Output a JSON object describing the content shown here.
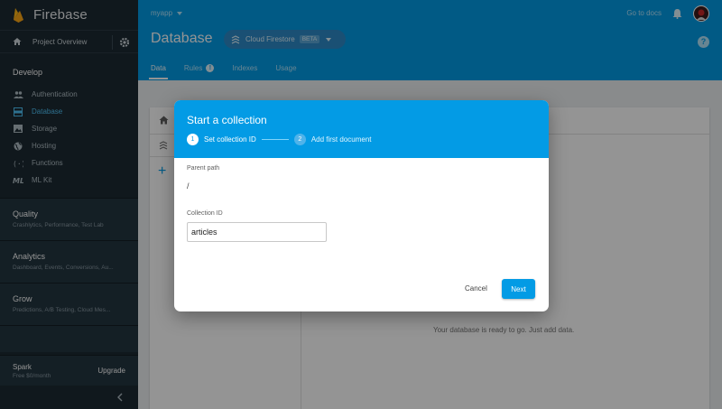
{
  "sidebar": {
    "brand": "Firebase",
    "overview": "Project Overview",
    "develop_title": "Develop",
    "develop_items": [
      {
        "label": "Authentication",
        "icon": "people-icon"
      },
      {
        "label": "Database",
        "icon": "database-icon"
      },
      {
        "label": "Storage",
        "icon": "image-icon"
      },
      {
        "label": "Hosting",
        "icon": "globe-icon"
      },
      {
        "label": "Functions",
        "icon": "functions-icon"
      },
      {
        "label": "ML Kit",
        "icon": "ml-icon"
      }
    ],
    "groups": [
      {
        "title": "Quality",
        "subtitle": "Crashlytics, Performance, Test Lab"
      },
      {
        "title": "Analytics",
        "subtitle": "Dashboard, Events, Conversions, Au..."
      },
      {
        "title": "Grow",
        "subtitle": "Predictions, A/B Testing, Cloud Mes..."
      }
    ],
    "plan": {
      "title": "Spark",
      "subtitle": "Free $0/month",
      "upgrade": "Upgrade"
    }
  },
  "header": {
    "project": "myapp",
    "go_to_docs": "Go to docs",
    "title": "Database",
    "db_picker": {
      "label": "Cloud Firestore",
      "badge": "BETA"
    },
    "help": "?",
    "tabs": [
      {
        "label": "Data",
        "active": true
      },
      {
        "label": "Rules",
        "badge": "!"
      },
      {
        "label": "Indexes"
      },
      {
        "label": "Usage"
      }
    ]
  },
  "main": {
    "empty_message": "Your database is ready to go. Just add data.",
    "add": "+"
  },
  "modal": {
    "title": "Start a collection",
    "steps": [
      {
        "num": "1",
        "label": "Set collection ID"
      },
      {
        "num": "2",
        "label": "Add first document"
      }
    ],
    "parent_path_label": "Parent path",
    "parent_path_value": "/",
    "collection_id_label": "Collection ID",
    "collection_id_value": "articles",
    "cancel": "Cancel",
    "next": "Next"
  },
  "colors": {
    "header": "#039be5",
    "sidebar": "#1d2a33",
    "active_nav": "#4fc3f7",
    "primary_button": "#039be5"
  }
}
